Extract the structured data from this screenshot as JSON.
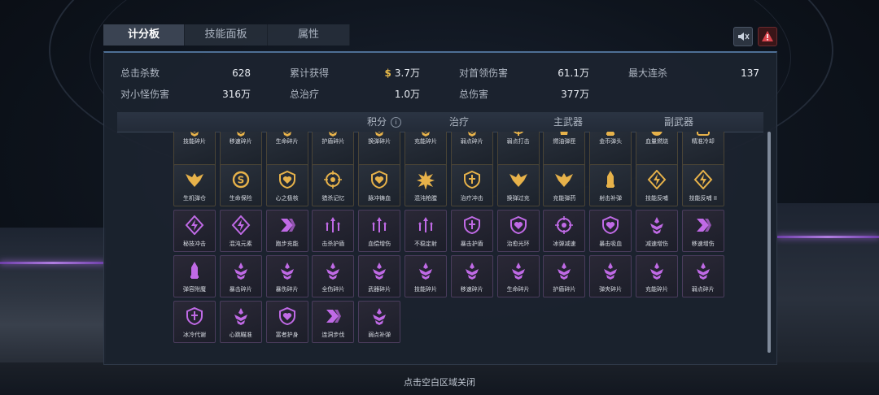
{
  "tabs": [
    {
      "label": "计分板"
    },
    {
      "label": "技能面板"
    },
    {
      "label": "属性"
    }
  ],
  "stats": {
    "total_kills": {
      "label": "总击杀数",
      "value": "628"
    },
    "total_earned": {
      "label": "累计获得",
      "currency": "$",
      "value": "3.7万"
    },
    "boss_damage": {
      "label": "对首领伤害",
      "value": "61.1万"
    },
    "max_streak": {
      "label": "最大连杀",
      "value": "137"
    },
    "minion_damage": {
      "label": "对小怪伤害",
      "value": "316万"
    },
    "total_heal": {
      "label": "总治疗",
      "value": "1.0万"
    },
    "total_damage": {
      "label": "总伤害",
      "value": "377万"
    }
  },
  "columns": {
    "score": "积分",
    "info_icon": "i",
    "heal": "治疗",
    "primary": "主武器",
    "secondary": "副武器"
  },
  "colors": {
    "gold": "#e7b24a",
    "purple": "#c06ae6",
    "accent": "#4e6f95"
  },
  "skills": {
    "row1": [
      {
        "name": "技能碎片",
        "icon": "triple-chevron-icon",
        "type": "gold"
      },
      {
        "name": "移速碎片",
        "icon": "triple-chevron-icon",
        "type": "gold"
      },
      {
        "name": "生命碎片",
        "icon": "triple-chevron-icon",
        "type": "gold"
      },
      {
        "name": "护盾碎片",
        "icon": "triple-chevron-icon",
        "type": "gold"
      },
      {
        "name": "换弹碎片",
        "icon": "triple-chevron-icon",
        "type": "gold"
      },
      {
        "name": "充能碎片",
        "icon": "triple-chevron-icon",
        "type": "gold"
      },
      {
        "name": "弱点碎片",
        "icon": "triple-chevron-icon",
        "type": "gold"
      },
      {
        "name": "弱点打击",
        "icon": "crosshair-icon",
        "type": "gold"
      },
      {
        "name": "燃油弹匣",
        "icon": "magazine-icon",
        "type": "gold"
      },
      {
        "name": "金币弹头",
        "icon": "bullet-icon",
        "type": "gold"
      },
      {
        "name": "血量燃烧",
        "icon": "flame-icon",
        "type": "gold"
      },
      {
        "name": "精准冷却",
        "icon": "timer-icon",
        "type": "gold"
      }
    ],
    "row2": [
      {
        "name": "生机弹仓",
        "icon": "wings-icon",
        "type": "gold"
      },
      {
        "name": "生命保险",
        "icon": "coin-icon",
        "type": "gold"
      },
      {
        "name": "心之极核",
        "icon": "heart-shield-icon",
        "type": "gold"
      },
      {
        "name": "猎杀记忆",
        "icon": "target-icon",
        "type": "gold"
      },
      {
        "name": "脉冲铸血",
        "icon": "heart-shield-icon",
        "type": "gold"
      },
      {
        "name": "混沌枪膛",
        "icon": "burst-icon",
        "type": "gold"
      },
      {
        "name": "治疗冲击",
        "icon": "shield-icon",
        "type": "gold"
      },
      {
        "name": "换弹过充",
        "icon": "wings-icon",
        "type": "gold"
      },
      {
        "name": "充能弹药",
        "icon": "wings-icon",
        "type": "gold"
      },
      {
        "name": "射击补弹",
        "icon": "bullet-icon",
        "type": "gold"
      },
      {
        "name": "技能反哺",
        "icon": "lightning-icon",
        "type": "gold"
      },
      {
        "name": "技能反哺 II",
        "icon": "lightning-icon",
        "type": "gold"
      }
    ],
    "row3": [
      {
        "name": "秘技冲击",
        "icon": "lightning-icon",
        "type": "purple"
      },
      {
        "name": "混沌元素",
        "icon": "lightning-icon",
        "type": "purple"
      },
      {
        "name": "跑步充能",
        "icon": "chevron-icon",
        "type": "purple"
      },
      {
        "name": "击杀护盾",
        "icon": "arrows-icon",
        "type": "purple"
      },
      {
        "name": "血偿增伤",
        "icon": "arrows-icon",
        "type": "purple"
      },
      {
        "name": "不稳定射",
        "icon": "arrows-icon",
        "type": "purple"
      },
      {
        "name": "暴击护盾",
        "icon": "shield-icon",
        "type": "purple"
      },
      {
        "name": "治愈光环",
        "icon": "heart-shield-icon",
        "type": "purple"
      },
      {
        "name": "冰弹减速",
        "icon": "target-icon",
        "type": "purple"
      },
      {
        "name": "暴击吸血",
        "icon": "heart-shield-icon",
        "type": "purple"
      },
      {
        "name": "减速增伤",
        "icon": "triple-chevron-icon",
        "type": "purple"
      },
      {
        "name": "移速增伤",
        "icon": "chevron-icon",
        "type": "purple"
      }
    ],
    "row4": [
      {
        "name": "弹容附魔",
        "icon": "bullet-icon",
        "type": "purple"
      },
      {
        "name": "暴击碎片",
        "icon": "triple-chevron-icon",
        "type": "purple"
      },
      {
        "name": "暴伤碎片",
        "icon": "triple-chevron-icon",
        "type": "purple"
      },
      {
        "name": "全伤碎片",
        "icon": "triple-chevron-icon",
        "type": "purple"
      },
      {
        "name": "武器碎片",
        "icon": "triple-chevron-icon",
        "type": "purple"
      },
      {
        "name": "技能碎片",
        "icon": "triple-chevron-icon",
        "type": "purple"
      },
      {
        "name": "移速碎片",
        "icon": "triple-chevron-icon",
        "type": "purple"
      },
      {
        "name": "生命碎片",
        "icon": "triple-chevron-icon",
        "type": "purple"
      },
      {
        "name": "护盾碎片",
        "icon": "triple-chevron-icon",
        "type": "purple"
      },
      {
        "name": "弹夹碎片",
        "icon": "triple-chevron-icon",
        "type": "purple"
      },
      {
        "name": "充能碎片",
        "icon": "triple-chevron-icon",
        "type": "purple"
      },
      {
        "name": "弱点碎片",
        "icon": "triple-chevron-icon",
        "type": "purple"
      }
    ],
    "row5": [
      {
        "name": "冰冷代谢",
        "icon": "shield-icon",
        "type": "purple"
      },
      {
        "name": "心跳瞄准",
        "icon": "triple-chevron-icon",
        "type": "purple"
      },
      {
        "name": "富者护身",
        "icon": "heart-shield-icon",
        "type": "purple"
      },
      {
        "name": "连洞步伐",
        "icon": "chevron-icon",
        "type": "purple"
      },
      {
        "name": "弱点补弹",
        "icon": "triple-chevron-icon",
        "type": "purple"
      }
    ]
  },
  "footer": {
    "hint": "点击空白区域关闭"
  }
}
